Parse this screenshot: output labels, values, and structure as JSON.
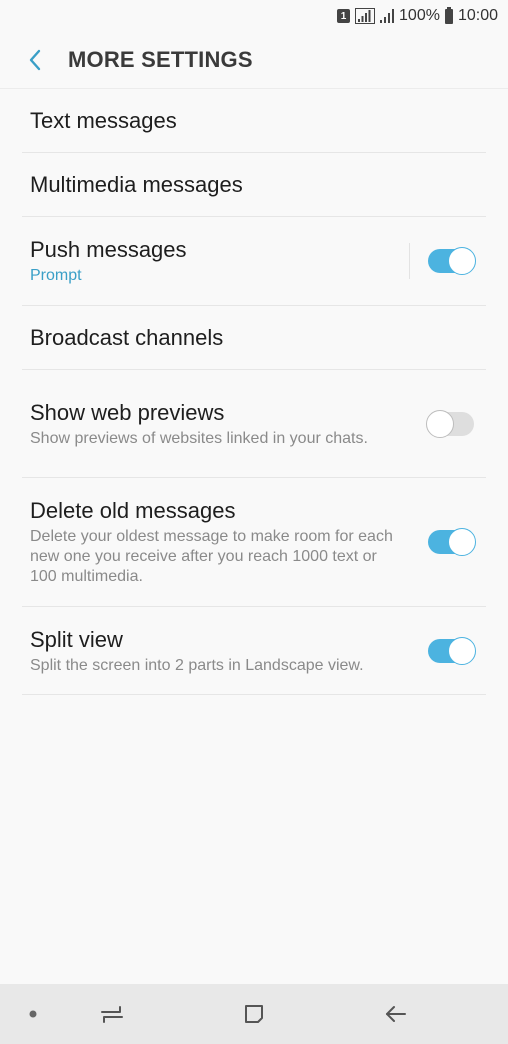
{
  "status_bar": {
    "sim_label": "1",
    "battery_text": "100%",
    "time": "10:00",
    "icons": [
      "sim-icon",
      "signal-icon",
      "signal-icon",
      "battery-icon"
    ]
  },
  "app_bar": {
    "title": "MORE SETTINGS",
    "back_icon": "chevron-left-icon"
  },
  "settings": {
    "text_messages": {
      "label": "Text messages"
    },
    "multimedia_messages": {
      "label": "Multimedia messages"
    },
    "push_messages": {
      "label": "Push messages",
      "sub": "Prompt",
      "enabled": true
    },
    "broadcast_channels": {
      "label": "Broadcast channels"
    },
    "web_previews": {
      "label": "Show web previews",
      "sub": "Show previews of websites linked in your chats.",
      "enabled": false
    },
    "delete_old": {
      "label": "Delete old messages",
      "sub": "Delete your oldest message to make room for each new one you receive after you reach 1000 text or 100 multimedia.",
      "enabled": true
    },
    "split_view": {
      "label": "Split view",
      "sub": "Split the screen into 2 parts in Landscape view.",
      "enabled": true
    }
  },
  "nav_bar": {
    "icons": [
      "dot-icon",
      "recent-apps-icon",
      "home-icon",
      "back-arrow-icon"
    ]
  },
  "colors": {
    "accent": "#4cb3e0",
    "accent_text": "#3a9fc7",
    "background": "#f9f9f9",
    "nav_background": "#e8e8e8"
  }
}
